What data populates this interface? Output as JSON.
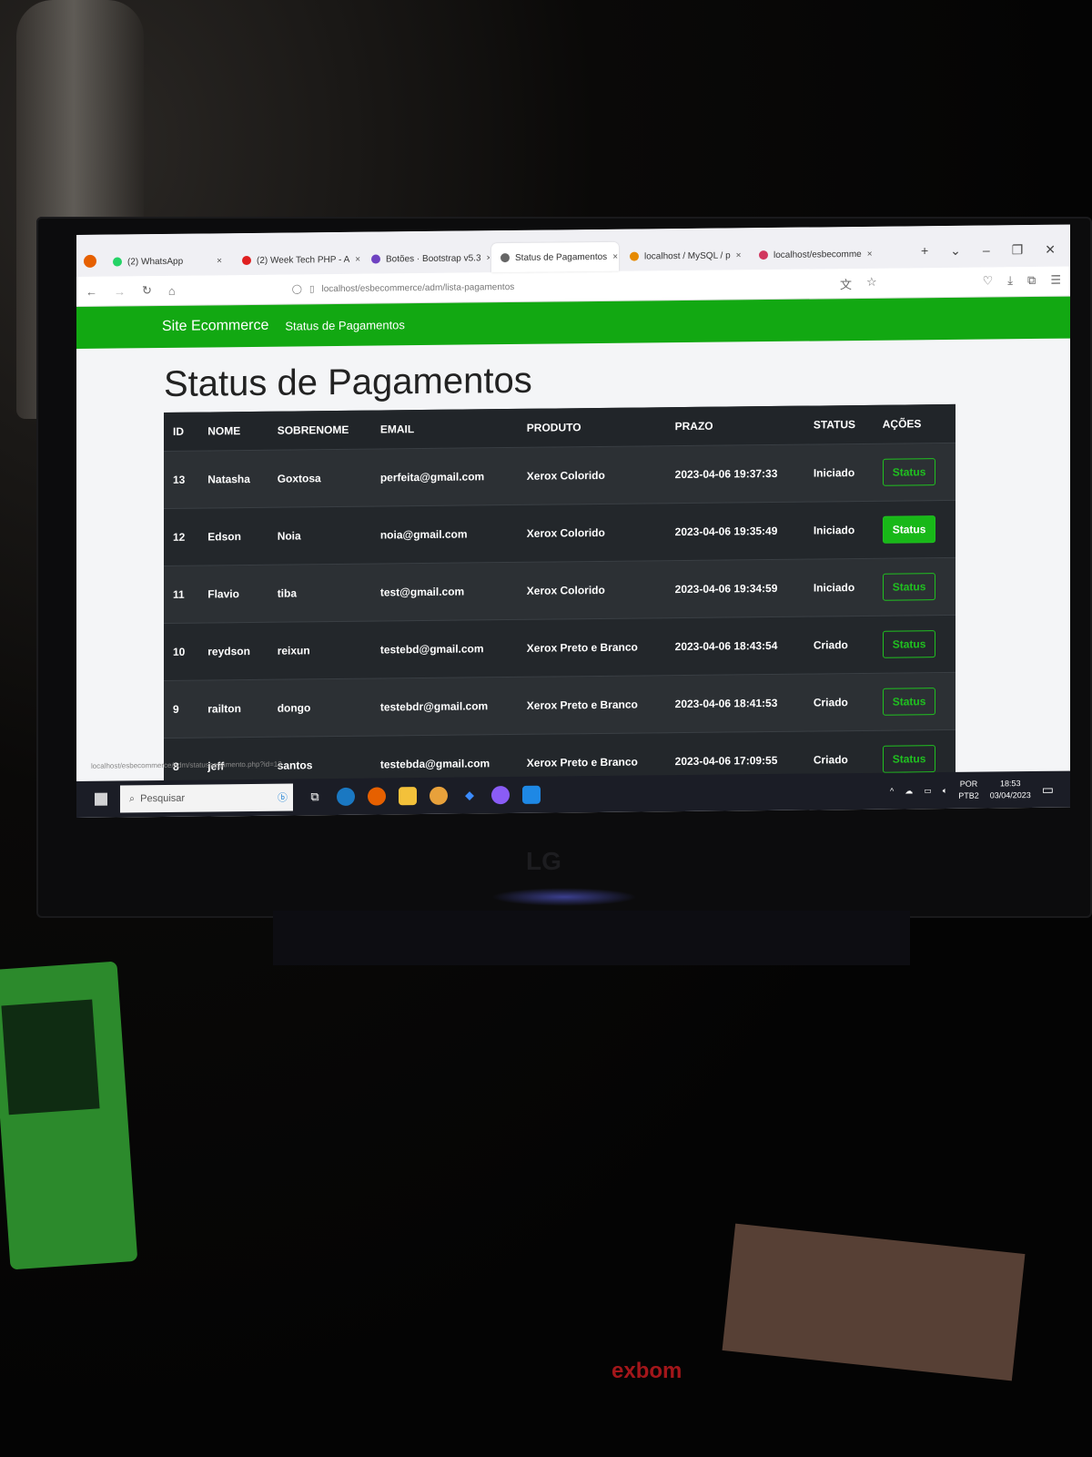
{
  "browser": {
    "tabs": [
      {
        "label": "(2) WhatsApp",
        "icon": "whatsapp-icon",
        "color": "#25d366"
      },
      {
        "label": "(2) Week Tech PHP - A",
        "icon": "youtube-icon",
        "color": "#e02020"
      },
      {
        "label": "Botões · Bootstrap v5.3",
        "icon": "bootstrap-icon",
        "color": "#6f42c1"
      },
      {
        "label": "Status de Pagamentos",
        "icon": "page-icon",
        "color": "#666666",
        "active": true
      },
      {
        "label": "localhost / MySQL / p",
        "icon": "phpmyadmin-icon",
        "color": "#e68a00"
      },
      {
        "label": "localhost/esbecomme",
        "icon": "app-icon",
        "color": "#d1365e"
      }
    ],
    "url": "localhost/esbecommerce/adm/lista-pagamentos",
    "status_url": "localhost/esbecommerce/adm/statuspagamento.php?id=12"
  },
  "navbar": {
    "brand": "Site Ecommerce",
    "link": "Status de Pagamentos",
    "color": "#12a812"
  },
  "page": {
    "title": "Status de Pagamentos"
  },
  "table": {
    "headers": [
      "ID",
      "NOME",
      "SOBRENOME",
      "EMAIL",
      "PRODUTO",
      "PRAZO",
      "STATUS",
      "AÇÕES"
    ],
    "rows": [
      {
        "id": "13",
        "nome": "Natasha",
        "sobrenome": "Goxtosa",
        "email": "perfeita@gmail.com",
        "produto": "Xerox Colorido",
        "prazo": "2023-04-06 19:37:33",
        "status": "Iniciado",
        "acao": "Status"
      },
      {
        "id": "12",
        "nome": "Edson",
        "sobrenome": "Noia",
        "email": "noia@gmail.com",
        "produto": "Xerox Colorido",
        "prazo": "2023-04-06 19:35:49",
        "status": "Iniciado",
        "acao": "Status"
      },
      {
        "id": "11",
        "nome": "Flavio",
        "sobrenome": "tiba",
        "email": "test@gmail.com",
        "produto": "Xerox Colorido",
        "prazo": "2023-04-06 19:34:59",
        "status": "Iniciado",
        "acao": "Status"
      },
      {
        "id": "10",
        "nome": "reydson",
        "sobrenome": "reixun",
        "email": "testebd@gmail.com",
        "produto": "Xerox Preto e Branco",
        "prazo": "2023-04-06 18:43:54",
        "status": "Criado",
        "acao": "Status"
      },
      {
        "id": "9",
        "nome": "railton",
        "sobrenome": "dongo",
        "email": "testebdr@gmail.com",
        "produto": "Xerox Preto e Branco",
        "prazo": "2023-04-06 18:41:53",
        "status": "Criado",
        "acao": "Status"
      },
      {
        "id": "8",
        "nome": "jeff",
        "sobrenome": "santos",
        "email": "testebda@gmail.com",
        "produto": "Xerox Preto e Branco",
        "prazo": "2023-04-06 17:09:55",
        "status": "Criado",
        "acao": "Status"
      }
    ]
  },
  "taskbar": {
    "search_placeholder": "Pesquisar",
    "lang": "POR",
    "layout": "PTB2",
    "time": "18:53",
    "date": "03/04/2023"
  },
  "photo": {
    "monitor_brand": "LG",
    "keyboard_brand": "exbom"
  }
}
